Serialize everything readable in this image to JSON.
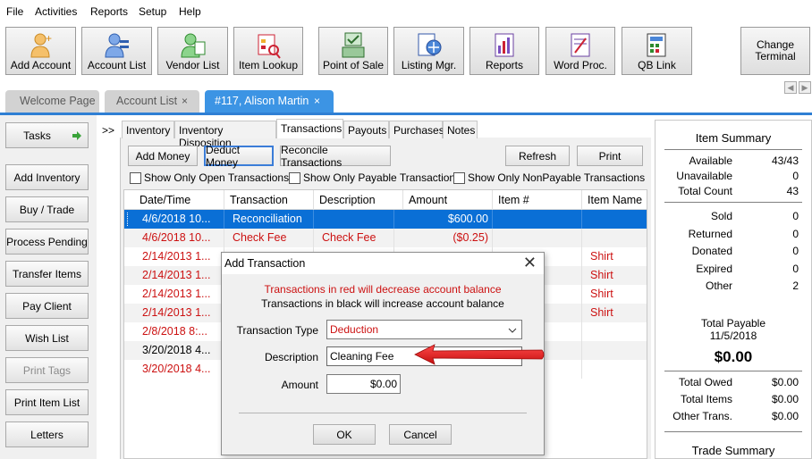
{
  "menu": [
    "File",
    "Activities",
    "Reports",
    "Setup",
    "Help"
  ],
  "toolbar": {
    "buttons": [
      {
        "label": "Add Account",
        "icon": "add-account-icon"
      },
      {
        "label": "Account List",
        "icon": "account-list-icon"
      },
      {
        "label": "Vendor List",
        "icon": "vendor-list-icon"
      },
      {
        "label": "Item Lookup",
        "icon": "item-lookup-icon"
      },
      {
        "label": "Point of Sale",
        "icon": "point-of-sale-icon"
      },
      {
        "label": "Listing Mgr.",
        "icon": "listing-manager-icon"
      },
      {
        "label": "Reports",
        "icon": "reports-icon"
      },
      {
        "label": "Word Proc.",
        "icon": "word-processor-icon"
      },
      {
        "label": "QB Link",
        "icon": "quickbooks-link-icon"
      }
    ],
    "change_terminal": "Change\nTerminal"
  },
  "tabs": [
    {
      "label": "Welcome Page",
      "active": false,
      "closable": false
    },
    {
      "label": "Account List",
      "active": false,
      "closable": true
    },
    {
      "label": "#117, Alison Martin",
      "active": true,
      "closable": true
    }
  ],
  "tab_close_glyph": "×",
  "sidebar": {
    "tasks_label": "Tasks",
    "items": [
      "Add Inventory",
      "Buy / Trade",
      "Process Pending",
      "Transfer Items",
      "Pay Client",
      "Wish List",
      "Print Tags",
      "Print Item List",
      "Letters"
    ],
    "disabled": [
      "Print Tags"
    ]
  },
  "inner_tabs": {
    "chevron": ">>",
    "items": [
      "Inventory",
      "Inventory Disposition",
      "Transactions",
      "Payouts",
      "Purchases",
      "Notes"
    ],
    "active": "Transactions"
  },
  "actions": {
    "add_money": "Add Money",
    "deduct_money": "Deduct Money",
    "reconcile": "Reconcile Transactions",
    "refresh": "Refresh",
    "print": "Print"
  },
  "filters": {
    "open": "Show Only Open Transactions",
    "payable": "Show Only Payable Transactions",
    "nonpayable": "Show Only NonPayable Transactions"
  },
  "grid": {
    "columns": [
      "Date/Time",
      "Transaction",
      "Description",
      "Amount",
      "Item #",
      "Item Name"
    ],
    "rows": [
      {
        "date": "4/6/2018 10...",
        "transaction": "Reconciliation",
        "description": "",
        "amount": "$600.00",
        "item_no": "",
        "item_name": "",
        "style": "selected"
      },
      {
        "date": "4/6/2018 10...",
        "transaction": "Check Fee",
        "description": "Check Fee",
        "amount": "($0.25)",
        "item_no": "",
        "item_name": "",
        "style": "red"
      },
      {
        "date": "2/14/2013 1...",
        "transaction": "",
        "description": "",
        "amount": "",
        "item_no": "",
        "item_name": "Shirt",
        "style": "red"
      },
      {
        "date": "2/14/2013 1...",
        "transaction": "",
        "description": "",
        "amount": "",
        "item_no": "",
        "item_name": "Shirt",
        "style": "red"
      },
      {
        "date": "2/14/2013 1...",
        "transaction": "",
        "description": "",
        "amount": "",
        "item_no": "",
        "item_name": "Shirt",
        "style": "red"
      },
      {
        "date": "2/14/2013 1...",
        "transaction": "",
        "description": "",
        "amount": "",
        "item_no": "",
        "item_name": "Shirt",
        "style": "red"
      },
      {
        "date": "2/8/2018 8:...",
        "transaction": "",
        "description": "",
        "amount": "",
        "item_no": "",
        "item_name": "",
        "style": "red"
      },
      {
        "date": "3/20/2018 4...",
        "transaction": "",
        "description": "",
        "amount": "",
        "item_no": "",
        "item_name": "",
        "style": "black"
      },
      {
        "date": "3/20/2018 4...",
        "transaction": "",
        "description": "",
        "amount": "",
        "item_no": "",
        "item_name": "",
        "style": "red"
      }
    ]
  },
  "summary": {
    "title": "Item Summary",
    "top": [
      {
        "label": "Available",
        "value": "43/43"
      },
      {
        "label": "Unavailable",
        "value": "0"
      },
      {
        "label": "Total Count",
        "value": "43"
      }
    ],
    "middle": [
      {
        "label": "Sold",
        "value": "0"
      },
      {
        "label": "Returned",
        "value": "0"
      },
      {
        "label": "Donated",
        "value": "0"
      },
      {
        "label": "Expired",
        "value": "0"
      },
      {
        "label": "Other",
        "value": "2"
      }
    ],
    "total_payable_label": "Total Payable",
    "total_payable_date": "11/5/2018",
    "total_payable_amount": "$0.00",
    "bottom": [
      {
        "label": "Total Owed",
        "value": "$0.00"
      },
      {
        "label": "Total Items",
        "value": "$0.00"
      },
      {
        "label": "Other Trans.",
        "value": "$0.00"
      }
    ],
    "trade_summary_title": "Trade Summary"
  },
  "dialog": {
    "title": "Add Transaction",
    "close": "✕",
    "note_red": "Transactions in red will decrease account balance",
    "note_black": "Transactions in black will increase account balance",
    "type_label": "Transaction Type",
    "type_value": "Deduction",
    "description_label": "Description",
    "description_value": "Cleaning Fee",
    "amount_label": "Amount",
    "amount_value": "$0.00",
    "ok": "OK",
    "cancel": "Cancel"
  },
  "colors": {
    "accent_blue": "#3c94e4",
    "selection_blue": "#0a6fd6",
    "negative_red": "#cc1111",
    "arrow_red": "#e01b1b"
  }
}
